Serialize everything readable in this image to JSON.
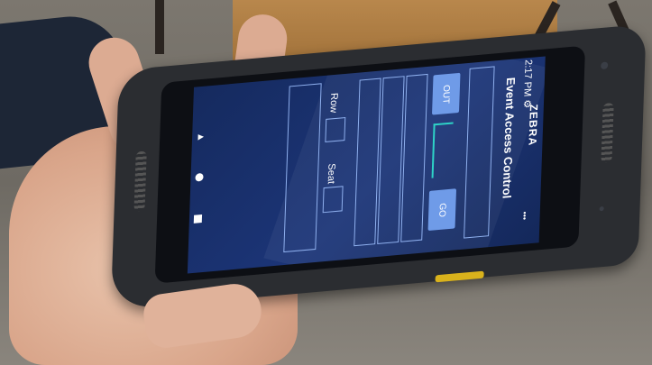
{
  "status_bar": {
    "time": "2:17 PM",
    "gear_icon": "gear-icon",
    "dots": "•••"
  },
  "app": {
    "title": "Event Access Control",
    "out_button": "OUT",
    "go_button": "GO",
    "row_label": "Row",
    "seat_label": "Seat"
  },
  "device": {
    "brand": "ZEBRA"
  },
  "nav": {
    "back_icon": "back-triangle-icon",
    "home_icon": "home-circle-icon",
    "recents_icon": "recents-square-icon"
  },
  "colors": {
    "screen_bg": "#1c3578",
    "button": "#6f9be8",
    "accent": "#2ed3c7"
  }
}
